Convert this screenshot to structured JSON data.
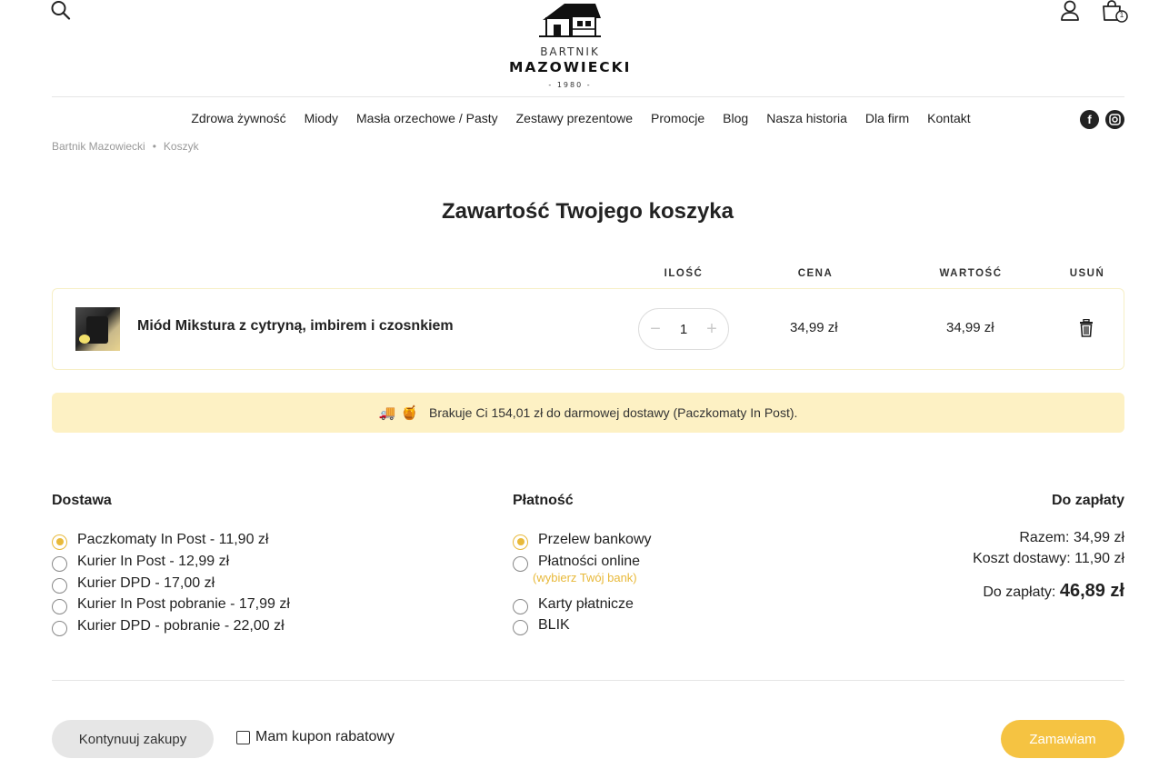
{
  "header": {
    "logo": {
      "line1": "BARTNIK",
      "line2": "MAZOWIECKI",
      "line3": "- 1980 -"
    },
    "cart_count": "1",
    "icons": [
      "search-icon",
      "logo-bee-house",
      "user-icon",
      "shopping-bag-icon"
    ]
  },
  "nav": {
    "items": [
      "Zdrowa żywność",
      "Miody",
      "Masła orzechowe / Pasty",
      "Zestawy prezentowe",
      "Promocje",
      "Blog",
      "Nasza historia",
      "Dla firm",
      "Kontakt"
    ],
    "social": {
      "facebook": "f",
      "instagram": "◎"
    }
  },
  "breadcrumb": {
    "home": "Bartnik Mazowiecki",
    "separator": "•",
    "current": "Koszyk"
  },
  "page_title": "Zawartość Twojego koszyka",
  "table": {
    "headers": {
      "qty": "ILOŚĆ",
      "price": "CENA",
      "value": "WARTOŚĆ",
      "remove": "USUŃ"
    },
    "items": [
      {
        "name": "Miód Mikstura z cytryną, imbirem i czosnkiem",
        "qty": "1",
        "minus": "−",
        "plus": "+",
        "price": "34,99 zł",
        "value": "34,99 zł"
      }
    ]
  },
  "notice": {
    "emoji1": "🚚",
    "emoji2": "🍯",
    "text": "Brakuje Ci 154,01 zł do darmowej dostawy (Paczkomaty In Post)."
  },
  "delivery": {
    "title": "Dostawa",
    "selected": 0,
    "options": [
      "Paczkomaty In Post - 11,90 zł",
      "Kurier In Post - 12,99 zł",
      "Kurier DPD - 17,00 zł",
      "Kurier In Post pobranie - 17,99 zł",
      "Kurier DPD - pobranie - 22,00 zł"
    ]
  },
  "payment": {
    "title": "Płatność",
    "selected": 0,
    "options": [
      "Przelew bankowy",
      "Płatności online",
      "Karty płatnicze",
      "BLIK"
    ],
    "online_hint": "(wybierz Twój bank)"
  },
  "summary": {
    "title": "Do zapłaty",
    "subtotal_label": "Razem:",
    "subtotal": "34,99 zł",
    "shipping_label": "Koszt dostawy:",
    "shipping": "11,90 zł",
    "total_label": "Do zapłaty:",
    "total": "46,89 zł"
  },
  "footer": {
    "continue_label": "Kontynuuj zakupy",
    "coupon_label": "Mam kupon rabatowy",
    "order_label": "Zamawiam"
  },
  "colors": {
    "accent": "#f5c342",
    "notice_bg": "#fdf1c4",
    "hint": "#e8b93a"
  }
}
